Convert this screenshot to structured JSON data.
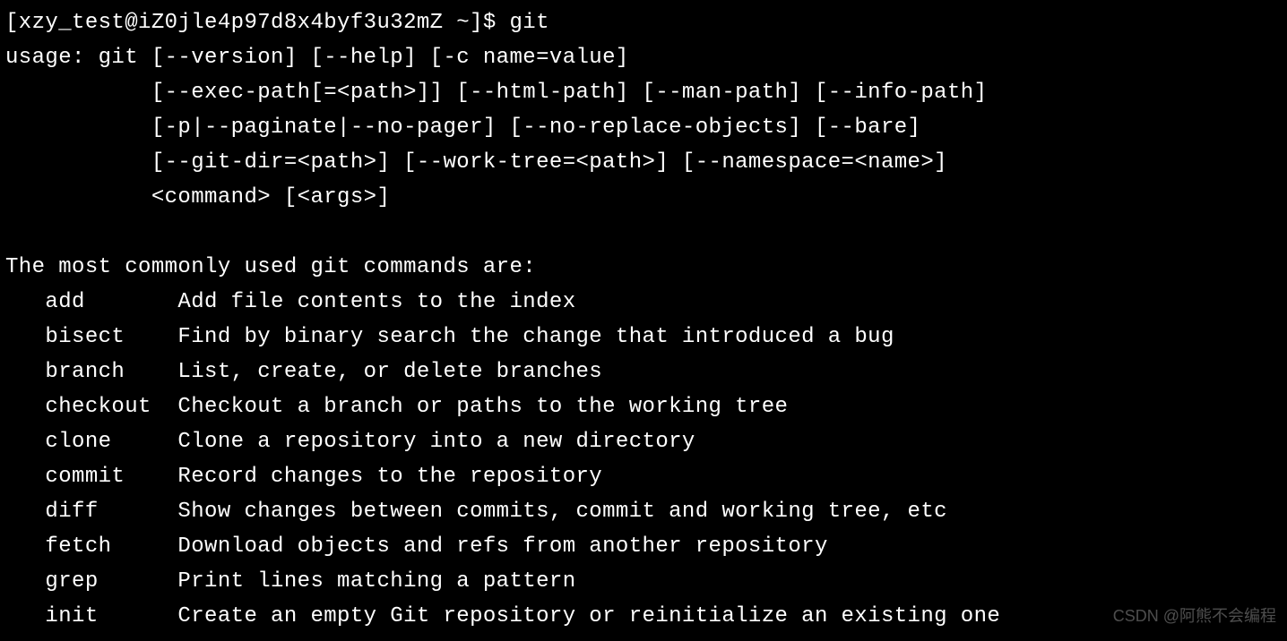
{
  "prompt": "[xzy_test@iZ0jle4p97d8x4byf3u32mZ ~]$ git",
  "usage": {
    "line1": "usage: git [--version] [--help] [-c name=value]",
    "line2": "           [--exec-path[=<path>]] [--html-path] [--man-path] [--info-path]",
    "line3": "           [-p|--paginate|--no-pager] [--no-replace-objects] [--bare]",
    "line4": "           [--git-dir=<path>] [--work-tree=<path>] [--namespace=<name>]",
    "line5": "           <command> [<args>]"
  },
  "heading": "The most commonly used git commands are:",
  "commands": [
    {
      "name": "add",
      "desc": "Add file contents to the index"
    },
    {
      "name": "bisect",
      "desc": "Find by binary search the change that introduced a bug"
    },
    {
      "name": "branch",
      "desc": "List, create, or delete branches"
    },
    {
      "name": "checkout",
      "desc": "Checkout a branch or paths to the working tree"
    },
    {
      "name": "clone",
      "desc": "Clone a repository into a new directory"
    },
    {
      "name": "commit",
      "desc": "Record changes to the repository"
    },
    {
      "name": "diff",
      "desc": "Show changes between commits, commit and working tree, etc"
    },
    {
      "name": "fetch",
      "desc": "Download objects and refs from another repository"
    },
    {
      "name": "grep",
      "desc": "Print lines matching a pattern"
    },
    {
      "name": "init",
      "desc": "Create an empty Git repository or reinitialize an existing one"
    }
  ],
  "watermark": "CSDN @阿熊不会编程"
}
